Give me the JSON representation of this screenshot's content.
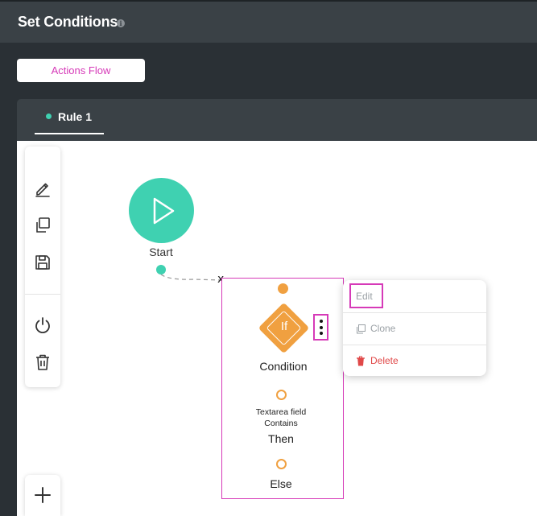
{
  "header": {
    "title": "Set Conditions",
    "info_icon": "info-icon"
  },
  "actions_flow": {
    "label": "Actions Flow"
  },
  "tabs": [
    {
      "label": "Rule 1",
      "active": true,
      "indicator_color": "#3fd1b1"
    }
  ],
  "toolbar": {
    "tools": [
      "pencil-icon",
      "copy-icon",
      "save-icon",
      "power-icon",
      "trash-icon"
    ],
    "add": "plus-icon"
  },
  "flow": {
    "start": {
      "label": "Start",
      "icon": "play-icon",
      "color": "#3fd1b1"
    },
    "connector_close": "x",
    "condition": {
      "badge": "If",
      "label": "Condition",
      "color": "#f0a040",
      "field_label_line1": "Textarea field",
      "field_label_line2": "Contains",
      "then_label": "Then",
      "else_label": "Else",
      "menu_icon": "kebab-icon"
    }
  },
  "context_menu": {
    "edit": "Edit",
    "clone": "Clone",
    "delete": "Delete"
  },
  "colors": {
    "accent": "#d63ab8",
    "start": "#3fd1b1",
    "condition": "#f0a040",
    "danger": "#e04848",
    "header_bg": "#3a4146",
    "page_bg": "#2a3035"
  }
}
